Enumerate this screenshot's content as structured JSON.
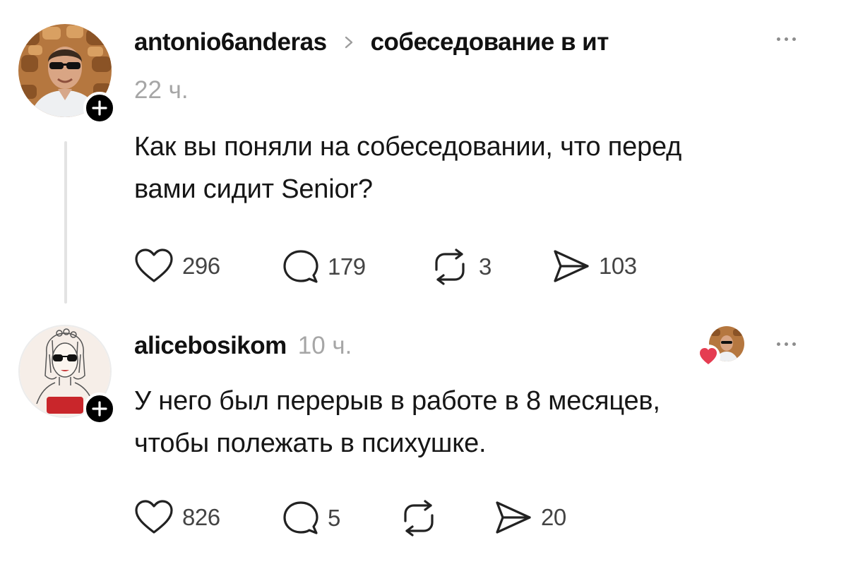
{
  "post": {
    "username": "antonio6anderas",
    "topic": "собеседование в ит",
    "time": "22 ч.",
    "text_lines": [
      "Как вы поняли на собеседовании, что перед",
      "вами сидит Senior?"
    ],
    "likes": "296",
    "replies": "179",
    "reposts": "3",
    "shares": "103"
  },
  "reply": {
    "username": "alicebosikom",
    "time": "10 ч.",
    "text_lines": [
      "У него был перерыв в работе в 8 месяцев,",
      "чтобы полежать в психушке."
    ],
    "likes": "826",
    "replies": "5",
    "shares": "20"
  },
  "icons": {
    "like": "heart-icon",
    "reply": "comment-bubble-icon",
    "repost": "repost-icon",
    "share": "send-icon",
    "add": "plus-icon",
    "more": "more-dots-icon",
    "liked_by_author": "red-heart-icon"
  },
  "colors": {
    "text": "#111111",
    "muted": "#9c9c9c",
    "icon": "#222222",
    "heart_badge": "#e53d51",
    "thread_line": "#e3e3e3"
  }
}
